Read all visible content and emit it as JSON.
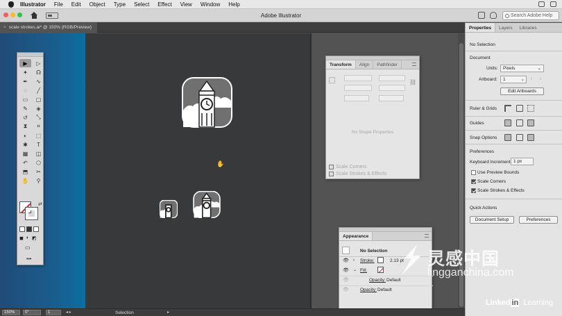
{
  "menubar": {
    "app": "Illustrator",
    "items": [
      "File",
      "Edit",
      "Object",
      "Type",
      "Select",
      "Effect",
      "View",
      "Window",
      "Help"
    ]
  },
  "appbar": {
    "title": "Adobe Illustrator",
    "search_placeholder": "Search Adobe Help"
  },
  "document": {
    "tab_close": "×",
    "tab_label": "scale strokes.ai* @ 150% (RGB/Preview)"
  },
  "tools": {
    "icons": [
      "selection-icon",
      "direct-selection-icon",
      "magic-wand-icon",
      "lasso-icon",
      "pen-icon",
      "curvature-icon",
      "type-icon",
      "line-icon",
      "rectangle-icon",
      "paintbrush-icon",
      "pencil-icon",
      "eraser-icon",
      "rotate-icon",
      "scale-icon",
      "width-icon",
      "free-transform-icon",
      "shape-builder-icon",
      "perspective-icon",
      "mesh-icon",
      "gradient-icon",
      "eyedropper-icon",
      "blend-icon",
      "symbol-sprayer-icon",
      "graph-icon",
      "artboard-icon",
      "slice-icon",
      "hand-icon",
      "zoom-icon"
    ],
    "glyphs": [
      "▶",
      "▷",
      "✦",
      "☊",
      "✒",
      "∿",
      "◌",
      "╱",
      "▭",
      "▢",
      "✎",
      "◈",
      "↺",
      "⤡",
      "⧗",
      "⌗",
      "◐",
      "⬚",
      "✱",
      "T",
      "▦",
      "◫",
      "↶",
      "⬡",
      "⬒",
      "✂",
      "✋",
      "🔍",
      "⚲",
      "⋯",
      "⊞",
      "⊟"
    ],
    "more": "•••"
  },
  "transform_panel": {
    "tabs": [
      "Transform",
      "Align",
      "Pathfinder"
    ],
    "message": "No Shape Properties",
    "options": [
      "Scale Corners",
      "Scale Strokes & Effects"
    ]
  },
  "appearance_panel": {
    "tab": "Appearance",
    "title": "No Selection",
    "rows": [
      {
        "label": "Stroke:",
        "value": "2.13 pt"
      },
      {
        "label": "Fill:",
        "value": ""
      },
      {
        "label": "Opacity:",
        "value": "Default"
      },
      {
        "label": "Opacity:",
        "value": "Default"
      }
    ]
  },
  "properties": {
    "tabs": [
      "Properties",
      "Layers",
      "Libraries"
    ],
    "no_selection": "No Selection",
    "document_label": "Document",
    "units_label": "Units:",
    "units_value": "Pixels",
    "artboard_label": "Artboard:",
    "artboard_value": "1",
    "edit_artboards": "Edit Artboards",
    "rulers_label": "Ruler & Grids",
    "guides_label": "Guides",
    "snap_label": "Snap Options",
    "preferences_label": "Preferences",
    "keyboard_increment_label": "Keyboard Increment:",
    "keyboard_increment_value": "1 px",
    "use_preview_bounds": "Use Preview Bounds",
    "scale_corners": "Scale Corners",
    "scale_strokes": "Scale Strokes & Effects",
    "quick_actions": "Quick Actions",
    "document_setup": "Document Setup",
    "preferences_btn": "Preferences"
  },
  "status": {
    "zoom": "150%",
    "rotation": "0°",
    "artboard": "1",
    "tool": "Selection"
  },
  "watermark": {
    "brand": "灵感中国",
    "url": "lingganchina.com",
    "linkedin": "Linked",
    "linkedin_in": "in",
    "learning": "Learning"
  },
  "colors": {
    "accent_red": "#e02020",
    "canvas": "#535353",
    "artboard": "#38393a"
  }
}
